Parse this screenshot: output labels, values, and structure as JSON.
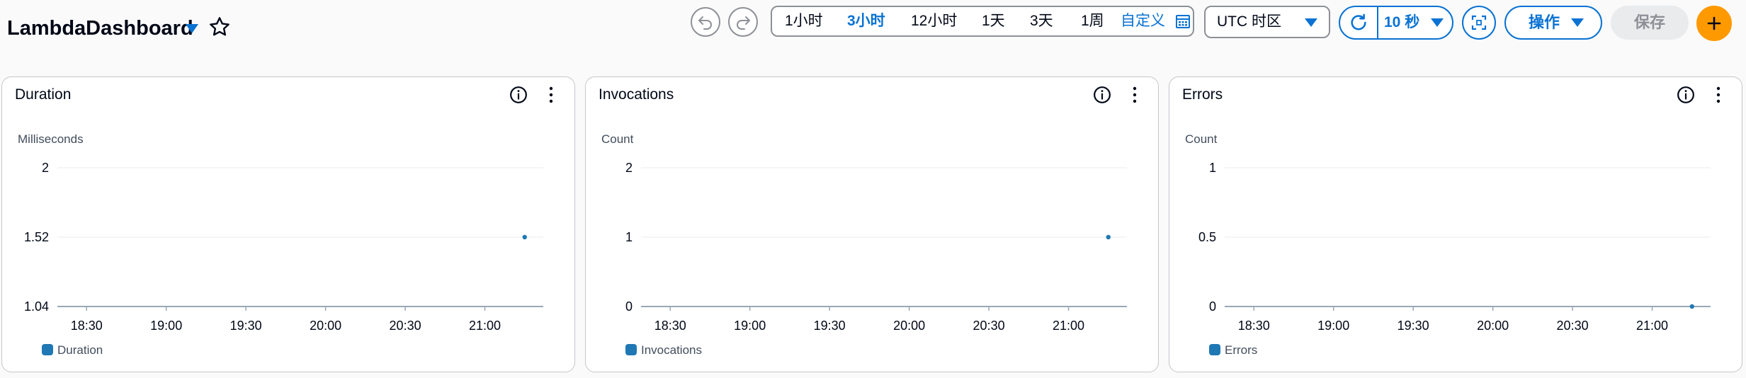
{
  "header": {
    "title": "LambdaDashboard",
    "time_ranges": [
      "1小时",
      "3小时",
      "12小时",
      "1天",
      "3天",
      "1周"
    ],
    "active_time_range": "3小时",
    "custom_label": "自定义",
    "timezone": "UTC 时区",
    "refresh_interval": "10 秒",
    "actions_label": "操作",
    "save_label": "保存"
  },
  "colors": {
    "accent": "#0972d3",
    "series": "#1f78b4",
    "add_button": "#ff9900"
  },
  "icons": [
    "chevron-down-icon",
    "star-icon",
    "undo-icon",
    "redo-icon",
    "calendar-icon",
    "refresh-icon",
    "fullscreen-icon",
    "plus-icon",
    "info-icon",
    "more-vertical-icon"
  ],
  "chart_data": [
    {
      "type": "line",
      "title": "Duration",
      "ylabel": "Milliseconds",
      "y_ticks": [
        "2",
        "1.52",
        "1.04"
      ],
      "ylim": [
        1.04,
        2
      ],
      "x_ticks": [
        "18:30",
        "19:00",
        "19:30",
        "20:00",
        "20:30",
        "21:00"
      ],
      "xlim": [
        "18:19",
        "21:22"
      ],
      "series": [
        {
          "name": "Duration",
          "points": [
            {
              "x": "21:15",
              "y": 1.52
            }
          ]
        }
      ],
      "grid": true,
      "legend": "bottom-left"
    },
    {
      "type": "line",
      "title": "Invocations",
      "ylabel": "Count",
      "y_ticks": [
        "2",
        "1",
        "0"
      ],
      "ylim": [
        0,
        2
      ],
      "x_ticks": [
        "18:30",
        "19:00",
        "19:30",
        "20:00",
        "20:30",
        "21:00"
      ],
      "xlim": [
        "18:19",
        "21:22"
      ],
      "series": [
        {
          "name": "Invocations",
          "points": [
            {
              "x": "21:15",
              "y": 1
            }
          ]
        }
      ],
      "grid": true,
      "legend": "bottom-left"
    },
    {
      "type": "line",
      "title": "Errors",
      "ylabel": "Count",
      "y_ticks": [
        "1",
        "0.5",
        "0"
      ],
      "ylim": [
        0,
        1
      ],
      "x_ticks": [
        "18:30",
        "19:00",
        "19:30",
        "20:00",
        "20:30",
        "21:00"
      ],
      "xlim": [
        "18:19",
        "21:22"
      ],
      "series": [
        {
          "name": "Errors",
          "points": [
            {
              "x": "21:15",
              "y": 0
            }
          ]
        }
      ],
      "grid": true,
      "legend": "bottom-left"
    }
  ]
}
